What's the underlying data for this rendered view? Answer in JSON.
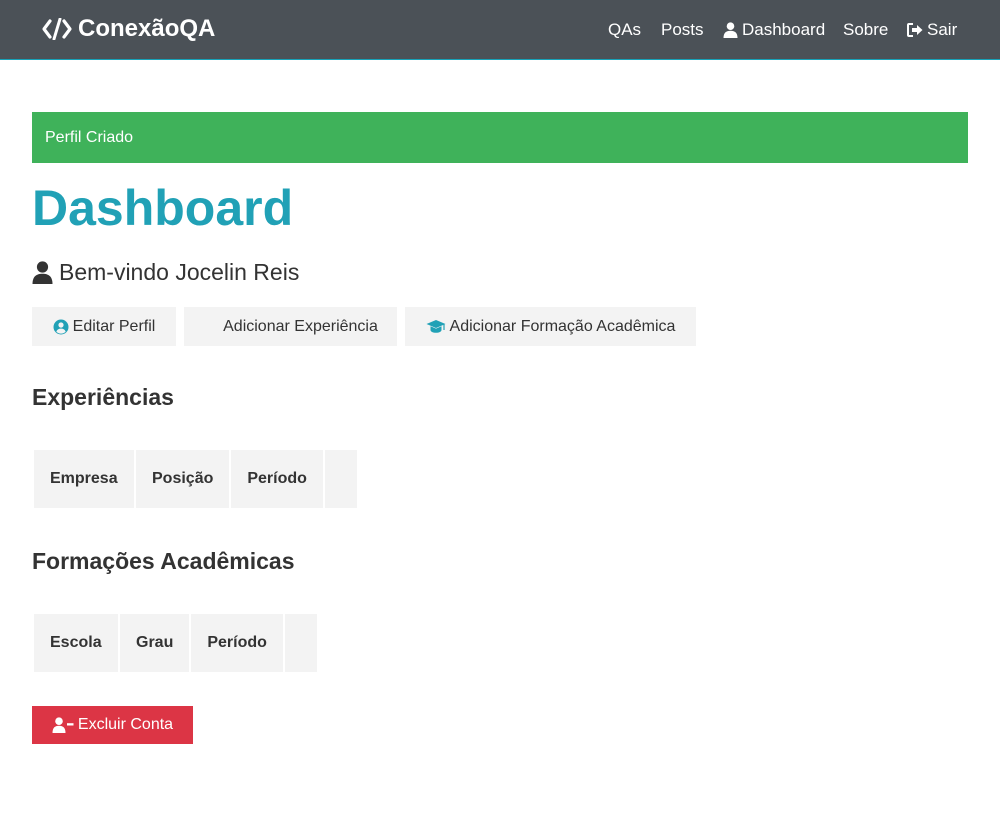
{
  "navbar": {
    "brand": "ConexãoQA",
    "links": {
      "qas": "QAs",
      "posts": "Posts",
      "dashboard": "Dashboard",
      "about": "Sobre",
      "logout": "Sair"
    }
  },
  "alert": {
    "message": "Perfil Criado",
    "color": "#3fb25a"
  },
  "page": {
    "title": "Dashboard",
    "welcome": "Bem-vindo Jocelin Reis"
  },
  "actions": {
    "edit_profile": "Editar Perfil",
    "add_experience": "Adicionar Experiência",
    "add_education": "Adicionar Formação Acadêmica"
  },
  "experiences": {
    "title": "Experiências",
    "columns": [
      "Empresa",
      "Posição",
      "Período",
      ""
    ]
  },
  "education": {
    "title": "Formações Acadêmicas",
    "columns": [
      "Escola",
      "Grau",
      "Período",
      ""
    ]
  },
  "delete_account": {
    "label": "Excluir Conta",
    "color": "#dc3545"
  },
  "colors": {
    "accent": "#21a1b6",
    "navbar": "#4b5157"
  },
  "icons": {
    "brand": "code-icon",
    "dashboard": "user-icon",
    "logout": "sign-out-icon",
    "welcome": "user-icon",
    "edit_profile": "user-circle-icon",
    "add_education": "graduation-cap-icon",
    "delete_account": "user-minus-icon"
  }
}
